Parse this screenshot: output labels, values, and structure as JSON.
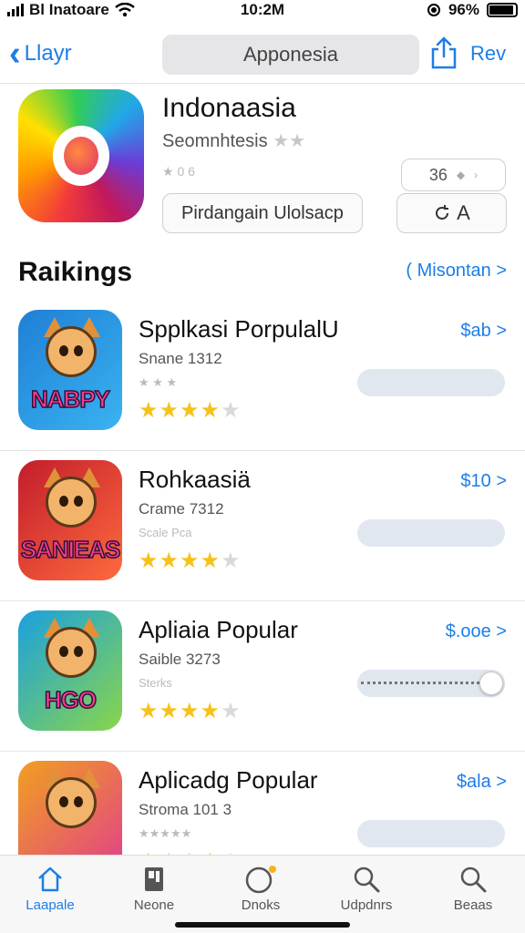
{
  "status_bar": {
    "carrier": "Bl Inatoare",
    "time": "10:2M",
    "battery": "96%"
  },
  "nav": {
    "back_label": "Llayr",
    "title": "Apponesia",
    "right_label": "Rev"
  },
  "app": {
    "name": "Indonaasia",
    "developer": "Seomnhtesis",
    "dev_stars": "★★",
    "small_rating": "★ 0 6",
    "install_label": "Pirdangain Ulolsacp",
    "version": "36",
    "lang_label": "A"
  },
  "rankings": {
    "title": "Raikings",
    "see_all": "( Misontan >",
    "items": [
      {
        "name": "Spplkasi PorpulalU",
        "sub": "Snane 1312",
        "small": "★ ★ ★",
        "price": "$ab >",
        "rating": 3.5,
        "word": "NABPY",
        "colors": [
          "#1f7fd6",
          "#3ab3f0"
        ]
      },
      {
        "name": "Rohkaasiä",
        "sub": "Crame 7312",
        "small": "Scale Pca",
        "price": "$10 >",
        "rating": 3.5,
        "word": "SANIEAS",
        "colors": [
          "#c21d2c",
          "#ff6a3d"
        ]
      },
      {
        "name": "Apliaia Popular",
        "sub": "Saible 3273",
        "small": "Sterks",
        "price": "$.ooe >",
        "rating": 3.5,
        "word": "HGO",
        "colors": [
          "#1aa0e0",
          "#8ad54a"
        ]
      },
      {
        "name": "Aplicadg Popular",
        "sub": "Stroma 101 3",
        "small": "★★★★★",
        "price": "$ala >",
        "rating": 3.5,
        "word": "",
        "colors": [
          "#f0a020",
          "#e23d8c"
        ]
      }
    ]
  },
  "tabs": [
    {
      "label": "Laapale",
      "icon": "home-icon",
      "active": true
    },
    {
      "label": "Neone",
      "icon": "book-icon",
      "active": false
    },
    {
      "label": "Dnoks",
      "icon": "compass-icon",
      "active": false
    },
    {
      "label": "Udpdnrs",
      "icon": "search-icon",
      "active": false
    },
    {
      "label": "Beaas",
      "icon": "search-icon",
      "active": false
    }
  ],
  "colors": {
    "accent": "#1c7ee8",
    "star": "#f6c21a"
  }
}
